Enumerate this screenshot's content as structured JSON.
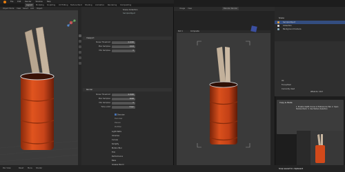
{
  "menu": {
    "items": [
      "File",
      "Edit",
      "Render",
      "Window",
      "Help"
    ]
  },
  "workspace_tabs": [
    "Layout",
    "Modeling",
    "Sculpting",
    "UV Editing",
    "Texture Paint",
    "Shading",
    "Animation",
    "Rendering",
    "Compositing"
  ],
  "viewport": {
    "header_menu": [
      "Object Mode",
      "View",
      "Select",
      "Add",
      "Object"
    ],
    "panel_title": "Render To The Screen",
    "panel_button": "Export Selected"
  },
  "properties": {
    "header": "Scene Collection",
    "subheader": "SampleObject",
    "sections": {
      "sampling": "Viewport",
      "render": "Render"
    },
    "viewport_rows": [
      {
        "label": "Noise Threshold",
        "value": "0.1000"
      },
      {
        "label": "Max Samples",
        "value": "1024"
      },
      {
        "label": "Min Samples",
        "value": "0"
      }
    ],
    "render_rows": [
      {
        "label": "Noise Threshold",
        "value": "0.0100"
      },
      {
        "label": "Max Samples",
        "value": "4096"
      },
      {
        "label": "Min Samples",
        "value": "0"
      },
      {
        "label": "Time Limit",
        "value": "0 sec"
      }
    ],
    "checks": [
      "Denoise",
      "Light Paths",
      "Volumes",
      "Curves",
      "Simplify",
      "Motion Blur",
      "Film",
      "Performance",
      "Bake",
      "Grease Pencil",
      "Freestyle"
    ],
    "denoise_subs": [
      "Denoiser",
      "Passes",
      "Prefilter"
    ]
  },
  "render_window": {
    "title": "Blender Render",
    "tabs": [
      "Image",
      "View"
    ],
    "slot_label": "Slot 1",
    "view_label": "Composite"
  },
  "outliner": {
    "title": "Scene",
    "rows": [
      "SampleObject",
      "Collection",
      "Background Camera"
    ]
  },
  "side_panel": {
    "rows": [
      "Ok",
      "Focus/Item",
      "Currently Used"
    ],
    "title": "What do I do?"
  },
  "notification": {
    "heading": "Copy & Paste",
    "body": "1. Enable UsePIL Scene in Preferences Tab. 2. Open Texture Paint. 3. Use Texture Selection"
  },
  "status": {
    "items": [
      "Pan View",
      "Reset",
      "Menu",
      "Shader"
    ],
    "clip_message": "Snip saved to clipboard"
  }
}
